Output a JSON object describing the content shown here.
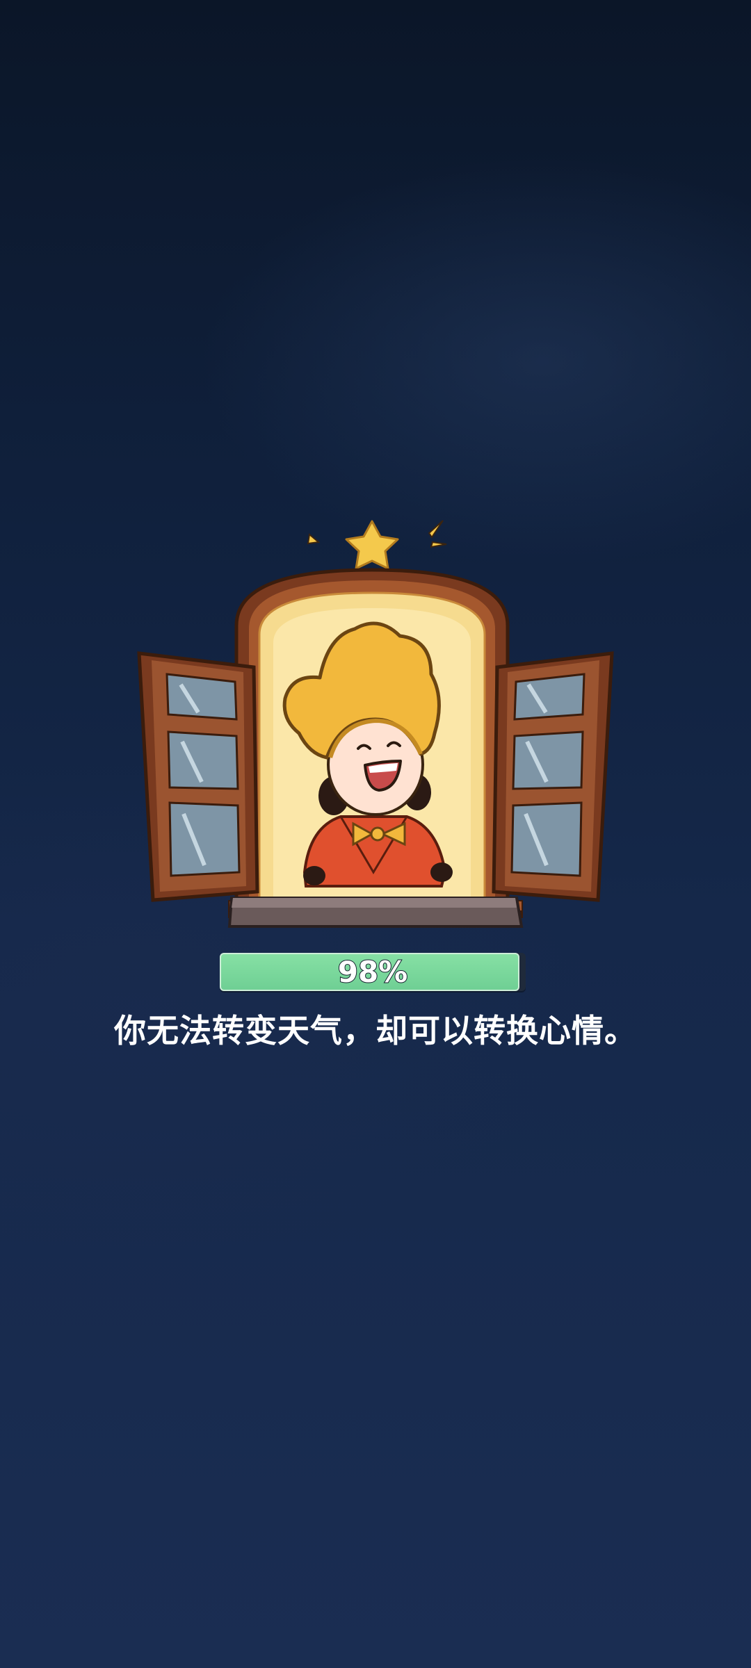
{
  "loading": {
    "progress_fraction": 0.98,
    "progress_label": "98%",
    "tip_text": "你无法转变天气，却可以转换心情。"
  },
  "illustration": {
    "subject": "child in yellow star-shaped hat waving from an open wooden window",
    "icons": [
      "star-icon",
      "sparkle-icon"
    ]
  },
  "colors": {
    "background_top": "#0b1628",
    "background_bottom": "#1a2d52",
    "progress_fill": "#6fcf94",
    "window_wood": "#8a4a2a",
    "window_glow": "#f6db8f",
    "hat_yellow": "#f2b83c",
    "cape_red": "#e0502e"
  }
}
